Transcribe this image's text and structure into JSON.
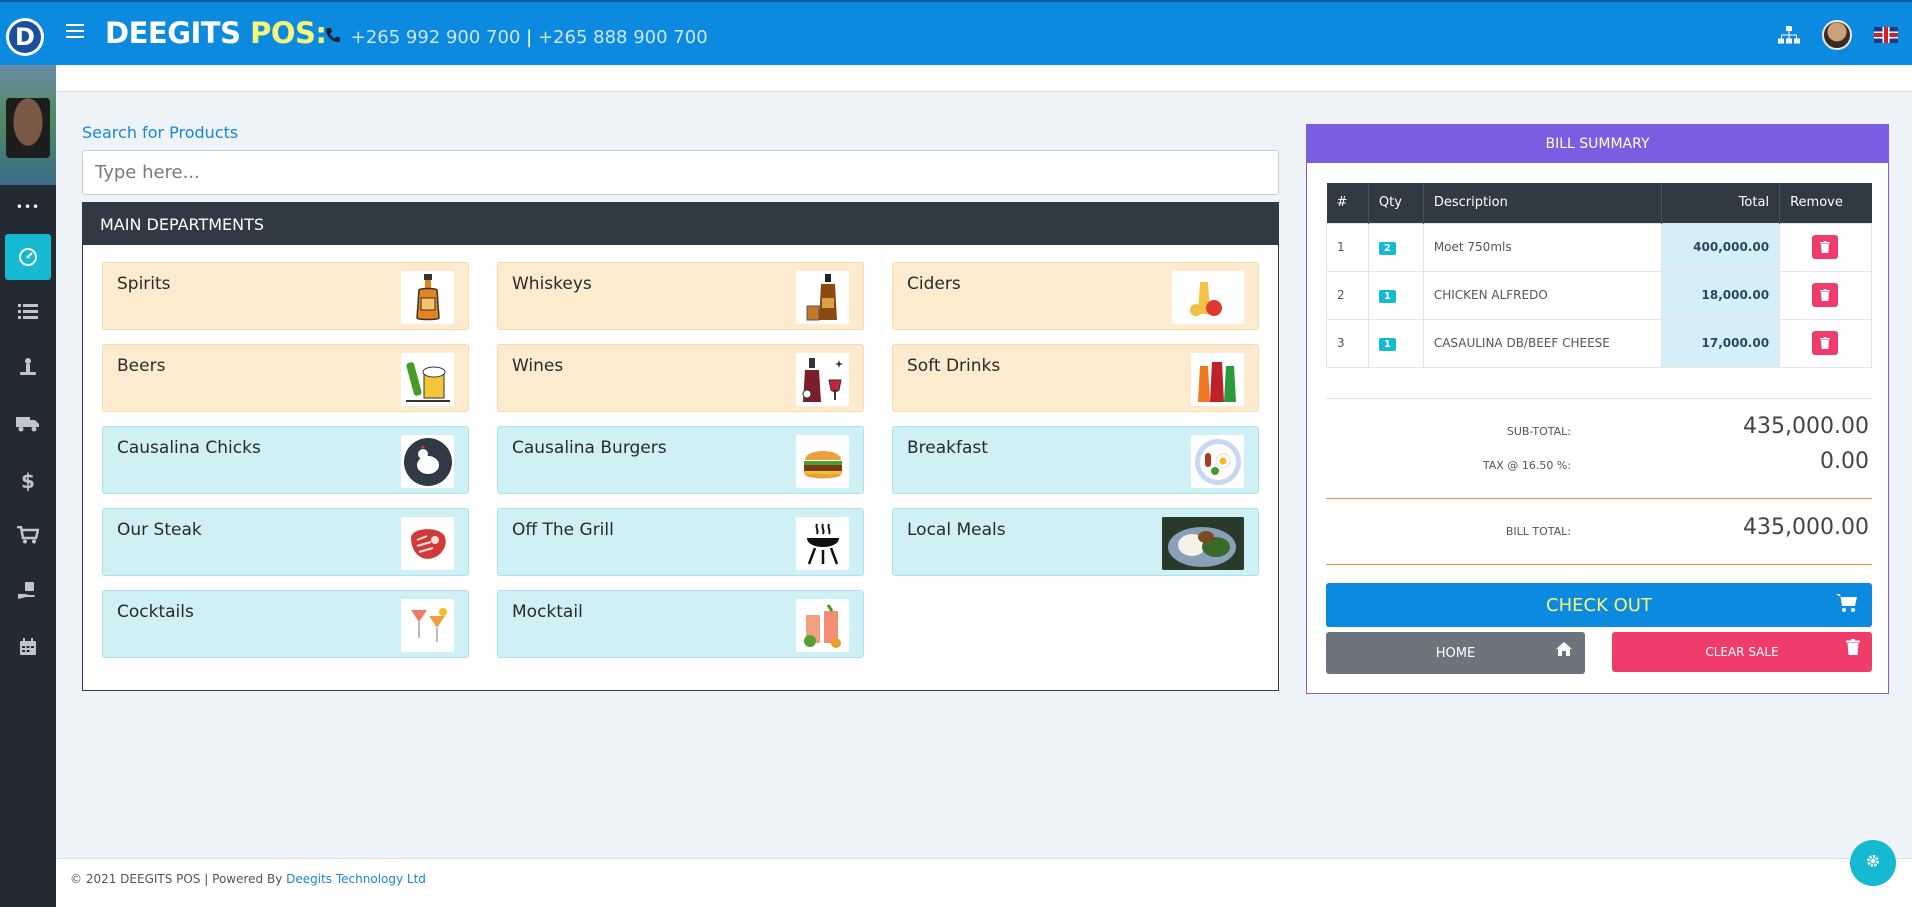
{
  "header": {
    "logo_letter": "D",
    "brand_main": "DEEGITS",
    "brand_accent": "POS:",
    "phone1": "+265 992 900 700",
    "phone_sep": "|",
    "phone2": "+265 888 900 700",
    "icons": [
      "sitemap-icon",
      "user-avatar",
      "uk-flag-icon"
    ]
  },
  "sidebar": {
    "dots": "•••",
    "items": [
      {
        "name": "dashboard",
        "icon": "dashboard-icon",
        "active": true
      },
      {
        "name": "list",
        "icon": "list-icon"
      },
      {
        "name": "stock",
        "icon": "stock-icon"
      },
      {
        "name": "delivery",
        "icon": "truck-icon"
      },
      {
        "name": "money",
        "icon": "dollar-icon"
      },
      {
        "name": "cart",
        "icon": "cart-icon"
      },
      {
        "name": "payments",
        "icon": "hand-money-icon"
      },
      {
        "name": "calendar",
        "icon": "calendar-icon"
      }
    ]
  },
  "search": {
    "label": "Search for Products",
    "placeholder": "Type here...",
    "value": ""
  },
  "departments": {
    "title": "MAIN DEPARTMENTS",
    "items": [
      {
        "name": "Spirits",
        "style": "warm"
      },
      {
        "name": "Whiskeys",
        "style": "warm"
      },
      {
        "name": "Ciders",
        "style": "warm"
      },
      {
        "name": "Beers",
        "style": "warm"
      },
      {
        "name": "Wines",
        "style": "warm"
      },
      {
        "name": "Soft Drinks",
        "style": "warm"
      },
      {
        "name": "Causalina Chicks",
        "style": "cool"
      },
      {
        "name": "Causalina Burgers",
        "style": "cool"
      },
      {
        "name": "Breakfast",
        "style": "cool"
      },
      {
        "name": "Our Steak",
        "style": "cool"
      },
      {
        "name": "Off The Grill",
        "style": "cool"
      },
      {
        "name": "Local Meals",
        "style": "cool"
      },
      {
        "name": "Cocktails",
        "style": "cool"
      },
      {
        "name": "Mocktail",
        "style": "cool"
      }
    ]
  },
  "bill": {
    "title": "BILL SUMMARY",
    "columns": {
      "num": "#",
      "qty": "Qty",
      "desc": "Description",
      "total": "Total",
      "remove": "Remove"
    },
    "rows": [
      {
        "num": "1",
        "qty": "2",
        "desc": "Moet 750mls",
        "total": "400,000.00"
      },
      {
        "num": "2",
        "qty": "1",
        "desc": "CHICKEN ALFREDO",
        "total": "18,000.00"
      },
      {
        "num": "3",
        "qty": "1",
        "desc": "CASAULINA DB/BEEF CHEESE",
        "total": "17,000.00"
      }
    ],
    "subtotal_label": "SUB-TOTAL:",
    "subtotal": "435,000.00",
    "tax_label": "TAX @ 16.50 %:",
    "tax": "0.00",
    "total_label": "BILL TOTAL:",
    "total": "435,000.00",
    "checkout_label": "CHECK OUT",
    "home_label": "HOME",
    "clear_label": "CLEAR SALE"
  },
  "footer": {
    "text": "© 2021 DEEGITS POS | Powered By",
    "link": "Deegits Technology Ltd"
  },
  "colors": {
    "topbar": "#0b8ae0",
    "sidebar": "#232a33",
    "accent_cyan": "#16b9d2",
    "bill_purple": "#7c5ce0",
    "danger": "#ef3c6a",
    "warm_card": "#fdebcf",
    "cool_card": "#cff0f5"
  }
}
